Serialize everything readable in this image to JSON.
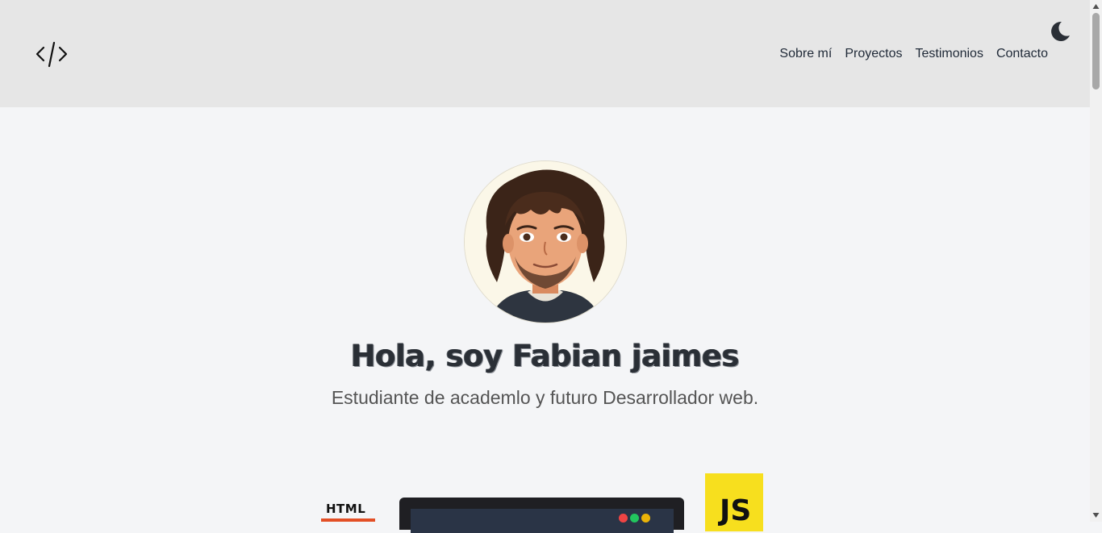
{
  "header": {
    "logo_icon": "code-icon",
    "nav": [
      {
        "label": "Sobre mí"
      },
      {
        "label": "Proyectos"
      },
      {
        "label": "Testimonios"
      },
      {
        "label": "Contacto"
      }
    ],
    "theme_toggle_icon": "moon-icon"
  },
  "hero": {
    "avatar_icon": "avatar-illustration",
    "title": "Hola, soy Fabian jaimes",
    "subtitle": "Estudiante de academlo y futuro Desarrollador web."
  },
  "skills": {
    "html_label": "HTML",
    "js_label": "JS"
  },
  "colors": {
    "header_bg": "#e6e6e6",
    "page_bg": "#f4f5f7",
    "html_orange": "#e34f26",
    "js_yellow": "#f7df1e"
  }
}
